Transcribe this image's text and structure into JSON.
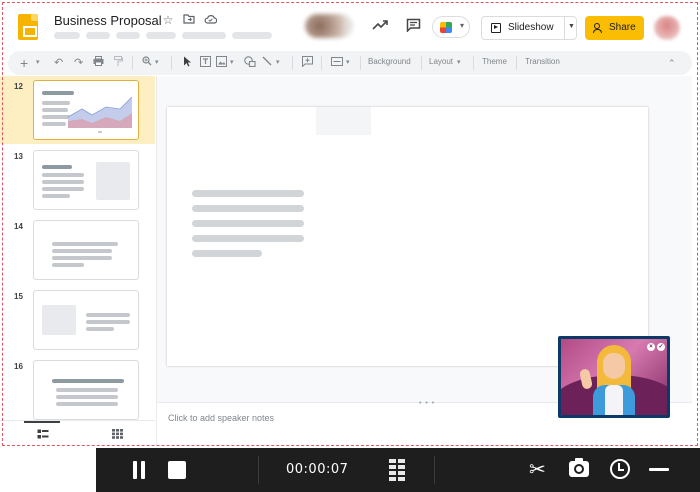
{
  "document": {
    "title": "Business Proposal"
  },
  "header": {
    "slideshow_label": "Slideshow",
    "share_label": "Share"
  },
  "toolbar": {
    "background_label": "Background",
    "layout_label": "Layout",
    "theme_label": "Theme",
    "transition_label": "Transition"
  },
  "filmstrip": {
    "slides": [
      {
        "number": "12",
        "selected": true
      },
      {
        "number": "13",
        "selected": false
      },
      {
        "number": "14",
        "selected": false
      },
      {
        "number": "15",
        "selected": false
      },
      {
        "number": "16",
        "selected": false
      }
    ]
  },
  "notes": {
    "placeholder": "Click to add speaker notes"
  },
  "recorder": {
    "elapsed_time": "00:00:07"
  },
  "colors": {
    "accent": "#fbbc04",
    "selected_slide": "#feefc3",
    "recording_frame": "#e25563",
    "recorder_bg": "#1e1e1e"
  },
  "icons": [
    "slides-logo-icon",
    "star-icon",
    "move-to-folder-icon",
    "cloud-saved-icon",
    "activity-trend-icon",
    "comment-icon",
    "meet-icon",
    "present-icon",
    "share-people-icon",
    "new-slide-icon",
    "undo-icon",
    "redo-icon",
    "print-icon",
    "paint-format-icon",
    "zoom-icon",
    "select-cursor-icon",
    "text-box-icon",
    "image-icon",
    "shape-icon",
    "line-icon",
    "add-comment-icon",
    "collapse-chevron-icon",
    "filmstrip-view-icon",
    "grid-view-icon",
    "pause-icon",
    "stop-icon",
    "scissors-icon",
    "camera-icon",
    "alarm-icon",
    "minimize-icon"
  ]
}
